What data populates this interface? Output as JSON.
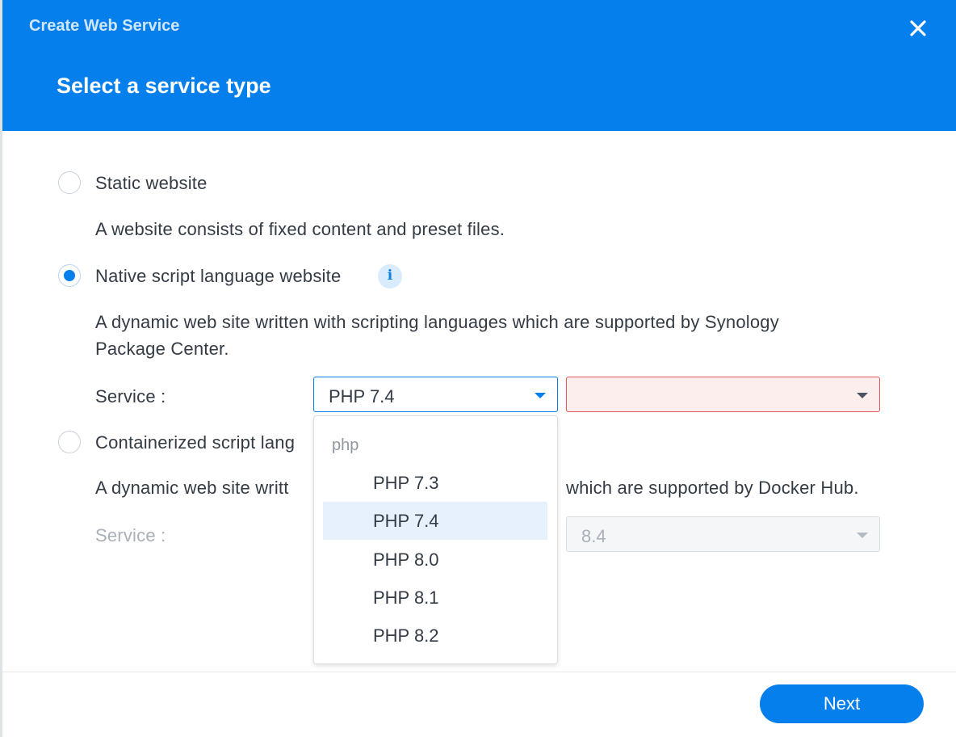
{
  "window": {
    "title": "Create Web Service",
    "close_icon": "close-icon"
  },
  "step": {
    "title": "Select a service type"
  },
  "options": [
    {
      "label": "Static website",
      "description": "A website consists of fixed content and preset files.",
      "selected": false
    },
    {
      "label": "Native script language website",
      "description_line1": "A dynamic web site written with scripting languages which are supported by Synology",
      "description_line2": "Package Center.",
      "selected": true,
      "info_icon": "info-icon"
    },
    {
      "label_visible": "Containerized script lang",
      "description_left": "A dynamic web site writt",
      "description_right": "which are supported by Docker Hub.",
      "selected": false
    }
  ],
  "native_service": {
    "label": "Service :",
    "selected_value": "PHP 7.4",
    "second_value": ""
  },
  "container_service": {
    "label": "Service :",
    "version_value": "8.4"
  },
  "dropdown": {
    "group": "php",
    "items": [
      "PHP 7.3",
      "PHP 7.4",
      "PHP 8.0",
      "PHP 8.1",
      "PHP 8.2"
    ],
    "active_index": 1
  },
  "footer": {
    "next_label": "Next"
  },
  "colors": {
    "accent": "#057feb",
    "error_border": "#e1595e",
    "error_bg": "#fdeeee"
  }
}
